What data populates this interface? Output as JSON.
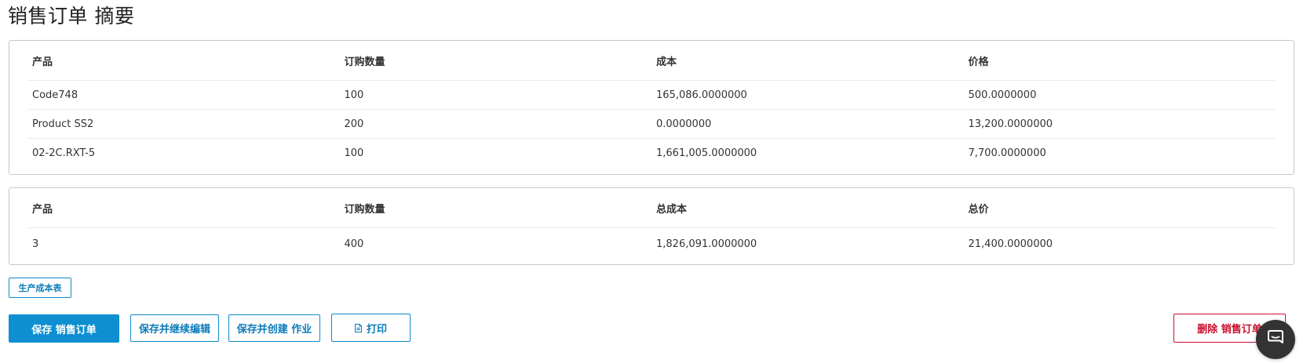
{
  "page": {
    "title": "销售订单 摘要"
  },
  "items_table": {
    "headers": [
      "产品",
      "订购数量",
      "成本",
      "价格"
    ],
    "rows": [
      [
        "Code748",
        "100",
        "165,086.0000000",
        "500.0000000"
      ],
      [
        "Product SS2",
        "200",
        "0.0000000",
        "13,200.0000000"
      ],
      [
        "02-2C.RXT-5",
        "100",
        "1,661,005.0000000",
        "7,700.0000000"
      ]
    ]
  },
  "totals_table": {
    "headers": [
      "产品",
      "订购数量",
      "总成本",
      "总价"
    ],
    "rows": [
      [
        "3",
        "400",
        "1,826,091.0000000",
        "21,400.0000000"
      ]
    ]
  },
  "actions": {
    "cost_sheet_label": "生产成本表",
    "save_label": "保存 销售订单",
    "save_continue_label": "保存并继续编辑",
    "save_create_label": "保存并创建 作业",
    "print_label": "打印",
    "delete_label": "删除 销售订单"
  },
  "icons": {
    "print": "document-icon",
    "chat": "chat-bubble-icon"
  },
  "colors": {
    "accent": "#0d8fd1",
    "danger": "#c8102e",
    "chat_launcher": "#333333"
  }
}
